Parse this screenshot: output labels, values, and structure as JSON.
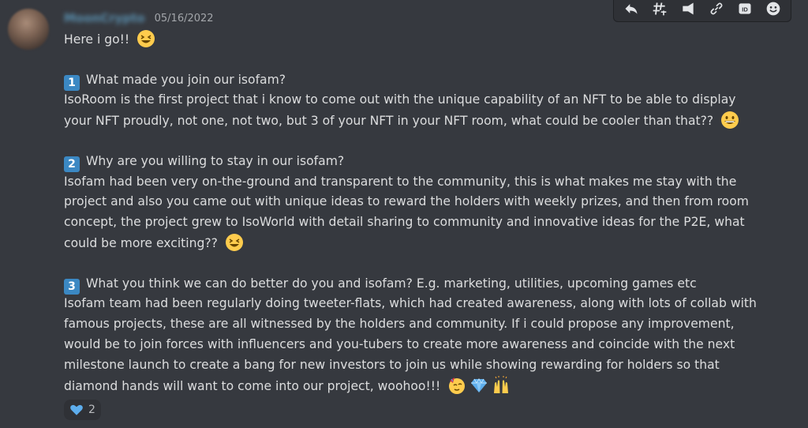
{
  "message": {
    "username": "MoonCrypto",
    "timestamp": "05/16/2022",
    "intro": "Here i go!!",
    "questions": [
      {
        "number": "1",
        "question": "What made you join our isofam?",
        "answer_lines": [
          "IsoRoom is the first project that i know to come out with the unique capability of an NFT to be able to display",
          "your NFT proudly, not one, not two, but 3 of your NFT in your NFT room, what could be cooler than that??"
        ]
      },
      {
        "number": "2",
        "question": "Why are you willing to stay in our isofam?",
        "answer_lines": [
          "Isofam had been very on-the-ground and transparent to the community, this is what makes me stay with the",
          "project and also you came out with unique ideas to reward the holders with weekly prizes, and then from room",
          "concept, the project grew to IsoWorld with detail sharing to community and innovative ideas for the P2E, what",
          "could be more exciting??"
        ]
      },
      {
        "number": "3",
        "question": "What you think we can do better do you and isofam? E.g. marketing, utilities, upcoming games etc",
        "answer_lines": [
          "Isofam team had been regularly doing tweeter-flats, which had created awareness, along with lots of collab with",
          "famous projects, these are all witnessed by the holders and community. If i could propose any improvement,",
          "would be to join forces with influencers and you-tubers to create more awareness and coincide with the next",
          "milestone launch to create a bang for new investors to join us while showing rewarding for holders so that",
          "diamond hands will want to come into our project, woohoo!!!"
        ]
      }
    ],
    "reaction": {
      "emoji": "blue-heart",
      "count": "2"
    }
  },
  "toolbar": {
    "buttons": [
      "reply-icon",
      "thread-icon",
      "pin-icon",
      "link-icon",
      "copy-id-icon",
      "add-reaction-icon"
    ],
    "id_label": "ID"
  },
  "colors": {
    "background": "#36393f",
    "text": "#dcddde",
    "timestamp": "#a3a6aa",
    "number_box": "#3b88c3"
  }
}
